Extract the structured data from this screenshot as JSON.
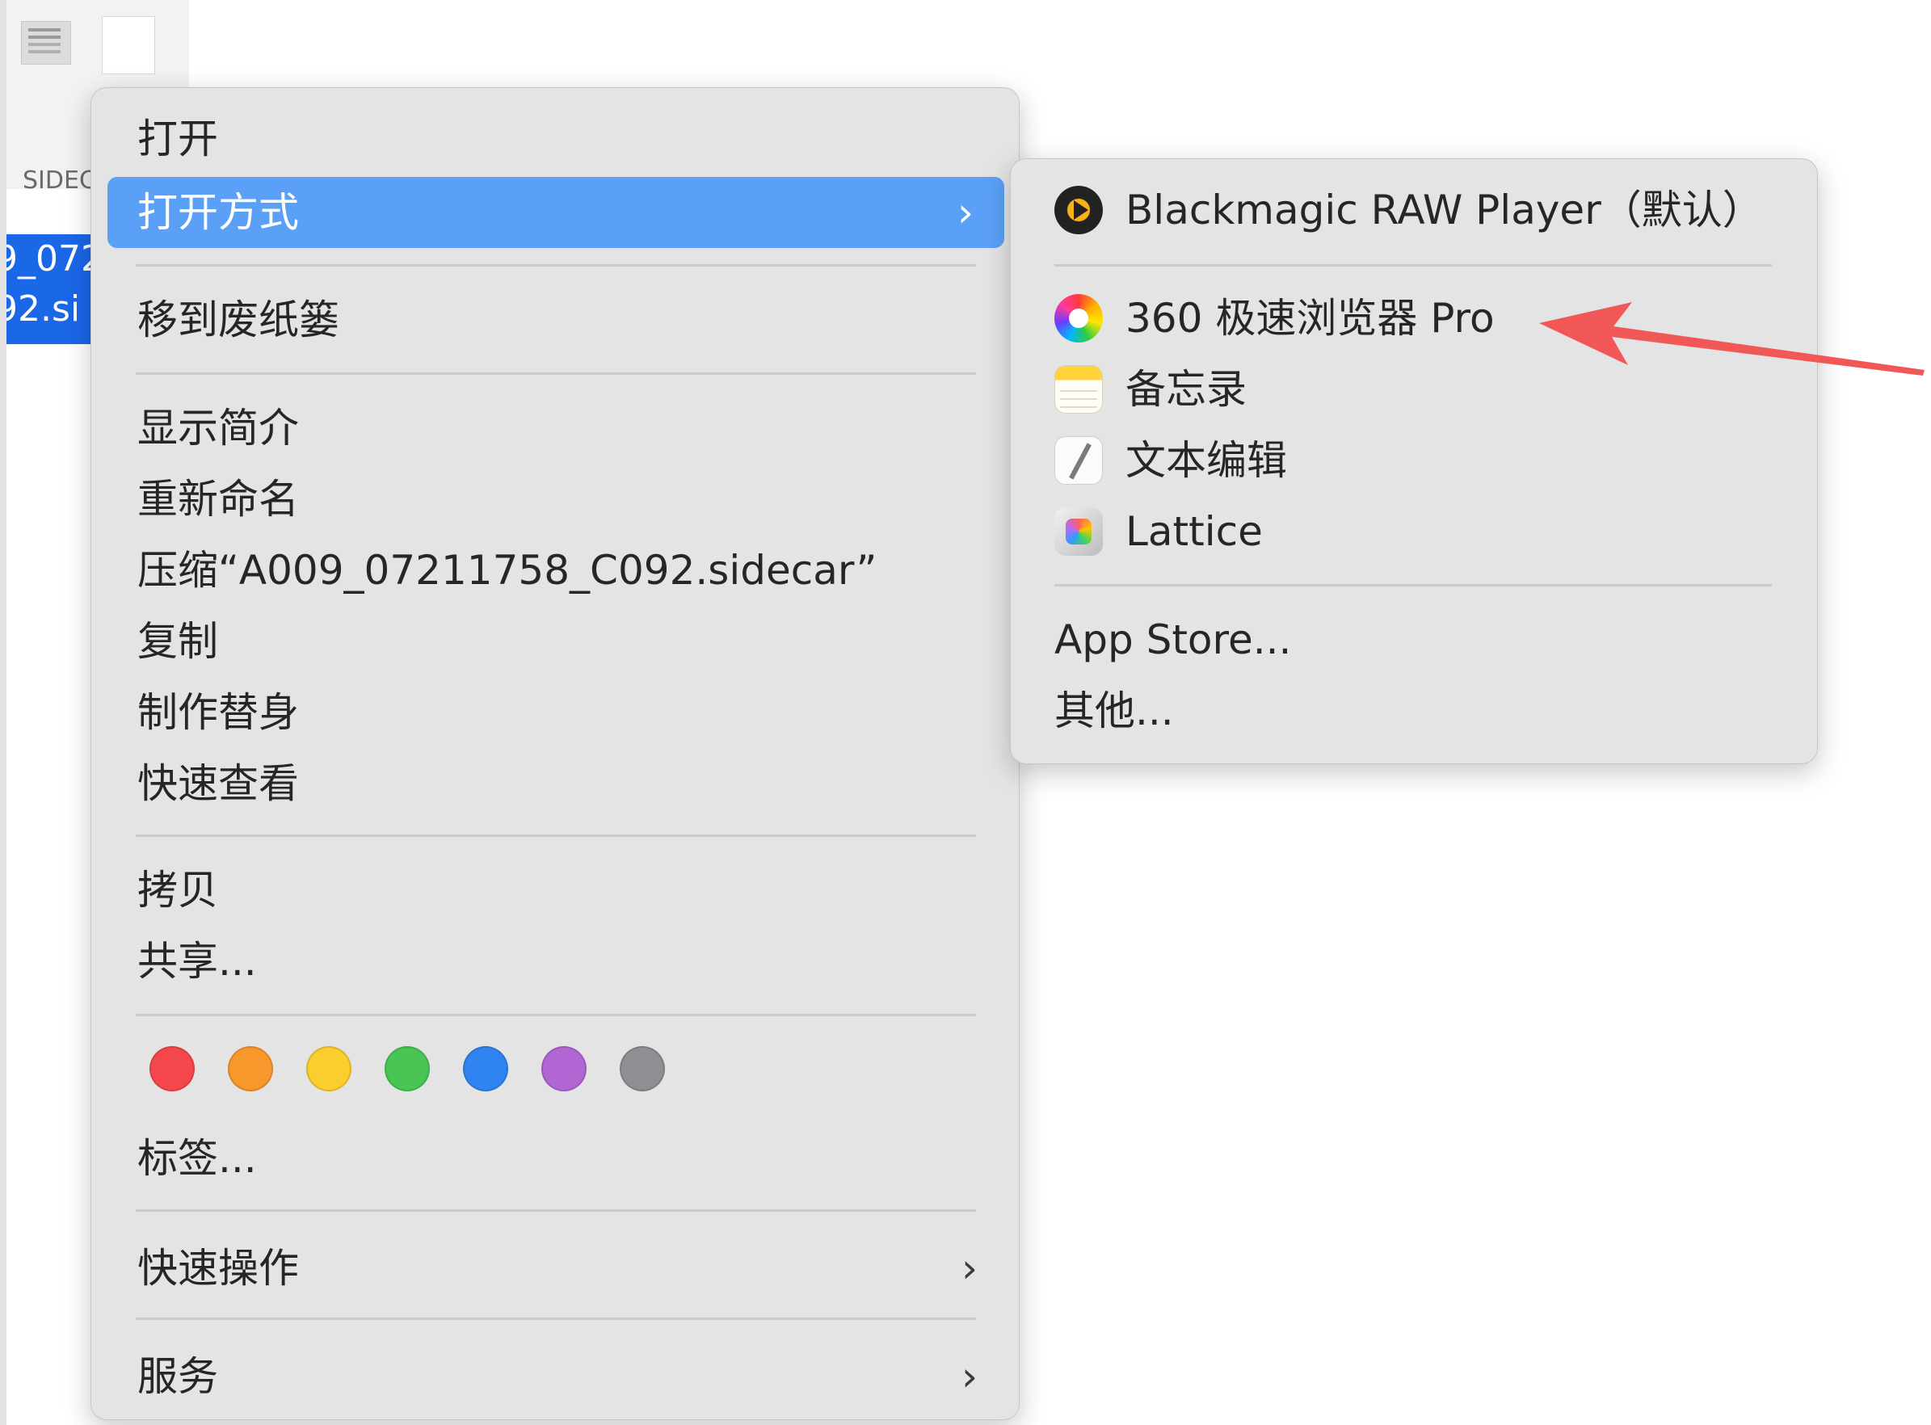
{
  "desktop": {
    "file_kind_label": "SIDEC",
    "file_name_line1": "9_072",
    "file_name_line2": "92.si"
  },
  "menu": {
    "open": "打开",
    "open_with": "打开方式",
    "move_to_trash": "移到废纸篓",
    "get_info": "显示简介",
    "rename": "重新命名",
    "compress": "压缩“A009_07211758_C092.sidecar”",
    "duplicate": "复制",
    "make_alias": "制作替身",
    "quick_look": "快速查看",
    "copy": "拷贝",
    "share": "共享...",
    "tags_label": "标签...",
    "quick_actions": "快速操作",
    "services": "服务",
    "chevron": "›",
    "tag_colors": [
      "#f4474b",
      "#f7972c",
      "#fbcd2f",
      "#48c552",
      "#2f84ef",
      "#b066d3",
      "#8f8f93"
    ]
  },
  "submenu": {
    "apps": [
      {
        "label": "Blackmagic RAW Player（默认）",
        "icon": "blackmagic-raw-player-icon"
      },
      {
        "label": "360 极速浏览器 Pro",
        "icon": "360-browser-icon"
      },
      {
        "label": "备忘录",
        "icon": "notes-icon"
      },
      {
        "label": "文本编辑",
        "icon": "textedit-icon"
      },
      {
        "label": "Lattice",
        "icon": "lattice-icon"
      }
    ],
    "app_store": "App Store...",
    "other": "其他..."
  },
  "annotation": {
    "arrow_color": "#f25757"
  }
}
